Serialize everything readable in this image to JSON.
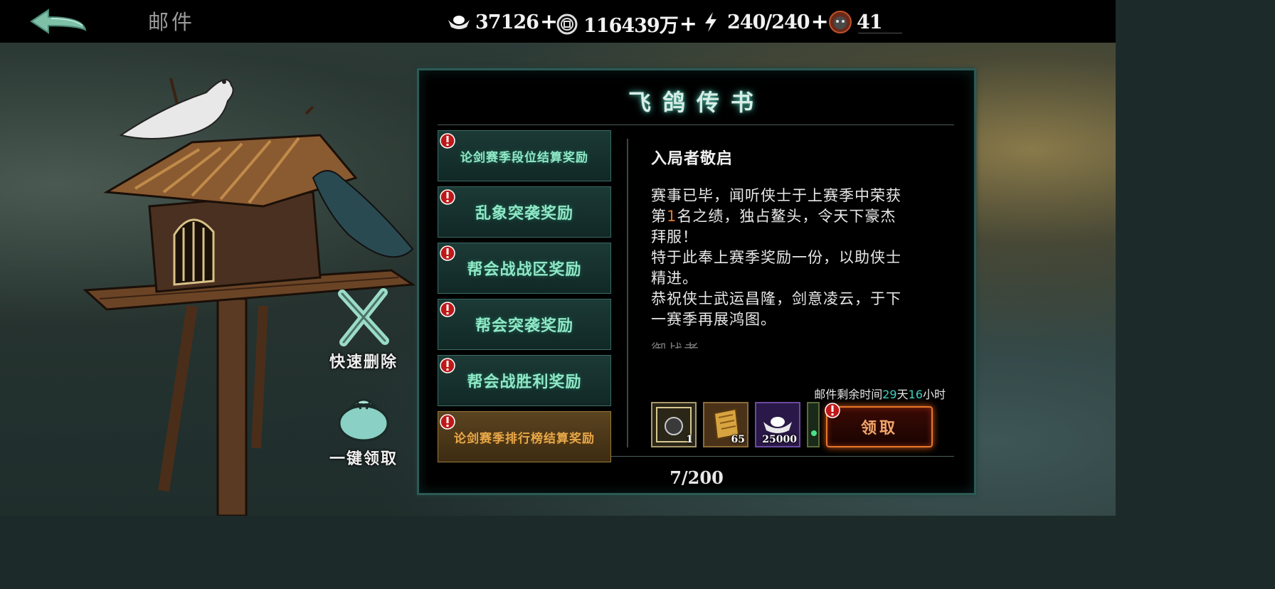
{
  "header": {
    "title": "邮件",
    "back_icon": "back-arrow-icon",
    "resources": [
      {
        "icon": "silver-ingot-icon",
        "value": "37126",
        "plus": "+"
      },
      {
        "icon": "copper-coin-icon",
        "value": "116439万",
        "plus": "+"
      },
      {
        "icon": "lightning-icon",
        "value": "240/240",
        "plus": "+"
      },
      {
        "icon": "demon-mask-icon",
        "value": "41"
      }
    ]
  },
  "side_actions": {
    "quick_delete": "快速删除",
    "claim_all": "一键领取"
  },
  "panel": {
    "title": "飞鸽传书",
    "mail_list": [
      {
        "label": "论剑赛季段位结算奖励",
        "active": false
      },
      {
        "label": "乱象突袭奖励",
        "active": false
      },
      {
        "label": "帮会战战区奖励",
        "active": false
      },
      {
        "label": "帮会突袭奖励",
        "active": false
      },
      {
        "label": "帮会战胜利奖励",
        "active": false
      },
      {
        "label": "论剑赛季排行榜结算奖励",
        "active": true
      }
    ],
    "mail": {
      "salutation": "入局者敬启",
      "line1a": "赛事已毕，闻听侠士于上赛季中荣获",
      "line2a": "第",
      "rank": "1",
      "line2b": "名之绩，独占鳌头，令天下豪杰",
      "line3": "拜服！",
      "line4": "特于此奉上赛季奖励一份，以助侠士",
      "line5": "精进。",
      "line6": "恭祝侠士武运昌隆，剑意凌云，于下",
      "line7": "一赛季再展鸿图。",
      "signature": "御战者"
    },
    "expire": {
      "prefix": "邮件剩余时间",
      "days": "29",
      "day_unit": "天",
      "hours": "16",
      "hour_unit": "小时"
    },
    "rewards": [
      {
        "icon": "avatar-frame-icon",
        "count": "1"
      },
      {
        "icon": "scroll-token-icon",
        "count": "65"
      },
      {
        "icon": "silver-ingot-icon",
        "count": "25000"
      },
      {
        "icon": "jade-item-icon",
        "count": ""
      }
    ],
    "claim_label": "领取",
    "page_count": "7/200"
  },
  "colors": {
    "accent_teal": "#8fe8c6",
    "active_gold": "#e8a84a",
    "highlight_orange": "#e07a2a",
    "claim_orange": "#e6782a",
    "timer_cyan": "#3fd0c0"
  }
}
